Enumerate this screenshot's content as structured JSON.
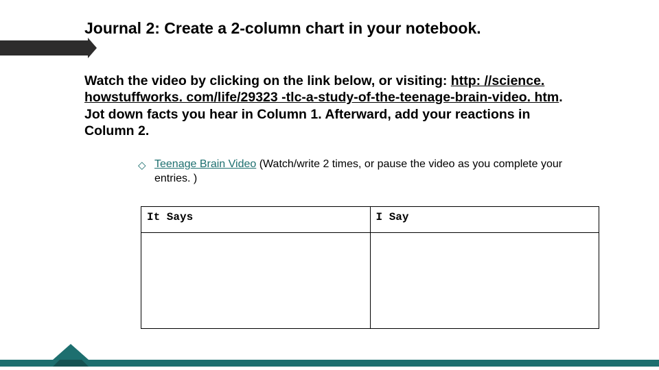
{
  "title": "Journal 2:  Create a 2-column chart in your notebook.",
  "instructions": {
    "lead": "Watch the video by clicking on the link below, or visiting: ",
    "url": "http: //science. howstuffworks. com/life/29323 -tlc-a-study-of-the-teenage-brain-video. htm",
    "after": ".  Jot down facts you hear in Column 1.  Afterward, add your reactions in Column 2."
  },
  "bullet": {
    "link_text": "Teenage Brain Video",
    "note": "  (Watch/write 2 times, or pause the video as you complete your entries. )"
  },
  "chart_data": {
    "type": "table",
    "headers": [
      "It Says",
      "I Say"
    ],
    "rows": [
      [
        "",
        ""
      ]
    ]
  }
}
